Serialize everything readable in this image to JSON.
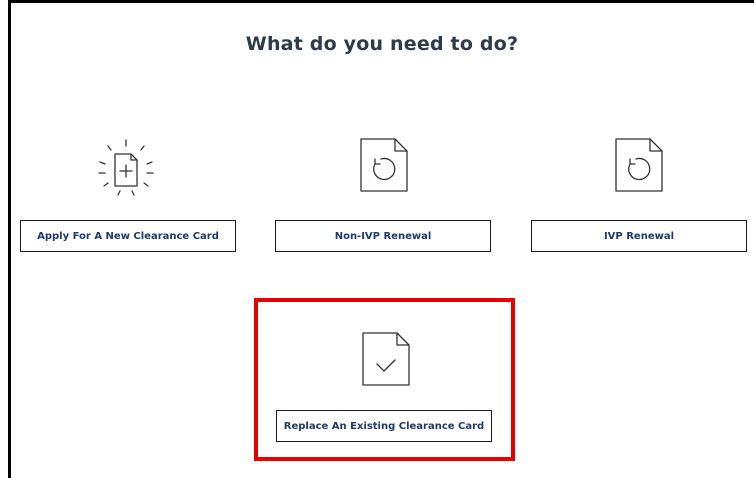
{
  "page": {
    "title": "What do you need to do?"
  },
  "options": [
    {
      "label": "Apply For A New Clearance Card",
      "icon": "document-add-icon"
    },
    {
      "label": "Non-IVP Renewal",
      "icon": "document-renew-icon"
    },
    {
      "label": "IVP Renewal",
      "icon": "document-renew-icon"
    },
    {
      "label": "Replace An Existing Clearance Card",
      "icon": "document-check-icon"
    }
  ],
  "colors": {
    "title": "#2d3a4a",
    "button_text": "#1f3a6b",
    "highlight": "#e60000"
  }
}
